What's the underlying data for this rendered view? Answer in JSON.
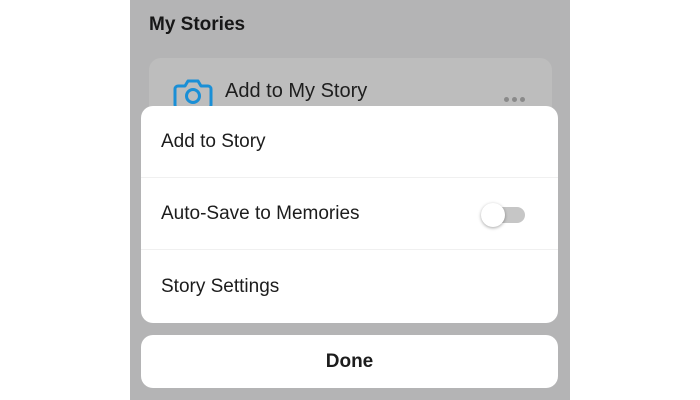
{
  "section": {
    "title": "My Stories"
  },
  "story_row": {
    "label": "Add to My Story",
    "icon": "camera-icon",
    "more_icon": "more-dots-icon"
  },
  "sheet": {
    "items": [
      {
        "label": "Add to Story"
      },
      {
        "label": "Auto-Save to Memories",
        "toggle": "off"
      },
      {
        "label": "Story Settings"
      }
    ]
  },
  "done": {
    "label": "Done"
  },
  "colors": {
    "accent": "#1a8fd6",
    "overlay": "#b4b4b5",
    "sheet": "#ffffff"
  }
}
